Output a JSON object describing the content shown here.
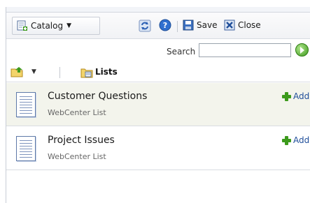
{
  "toolbar": {
    "catalog_label": "Catalog",
    "save_label": "Save",
    "close_label": "Close"
  },
  "search": {
    "label": "Search",
    "value": "",
    "placeholder": ""
  },
  "breadcrumb": {
    "current": "Lists"
  },
  "lists": [
    {
      "title": "Customer Questions",
      "subtitle": "WebCenter List",
      "add_label": "Add",
      "selected": true
    },
    {
      "title": "Project Issues",
      "subtitle": "WebCenter List",
      "add_label": "Add",
      "selected": false
    }
  ],
  "icons": {
    "catalog": "catalog-add-icon",
    "refresh": "refresh-icon",
    "help": "help-icon",
    "save": "save-disk-icon",
    "close": "close-x-icon",
    "go": "go-arrow-icon",
    "folder_up": "folder-up-icon",
    "lists_folder": "folder-list-icon",
    "list_item": "list-document-icon",
    "add": "plus-icon"
  },
  "colors": {
    "accent_green": "#3c9a1c",
    "link_blue": "#1f4e9a",
    "selected_row": "#f3f4ec"
  }
}
